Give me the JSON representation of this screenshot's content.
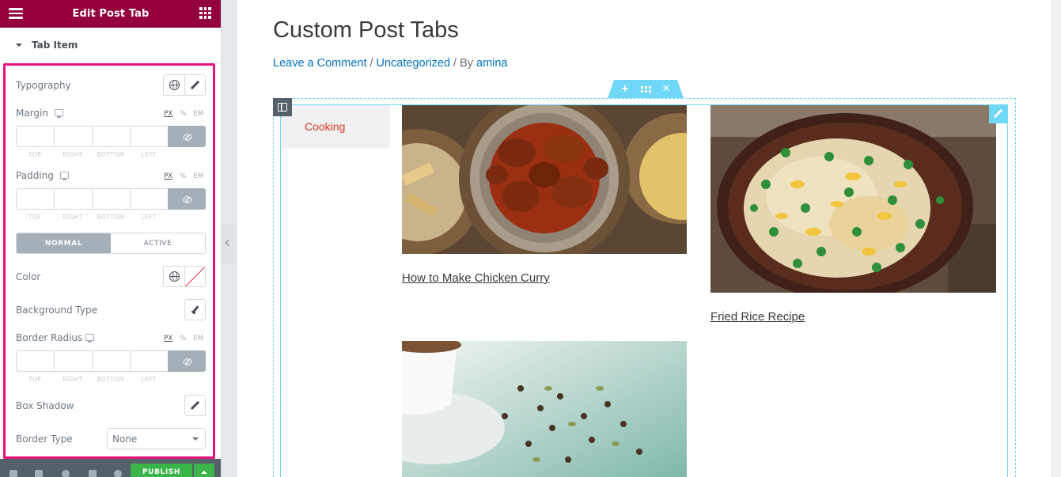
{
  "editor": {
    "header_title": "Edit Post Tab",
    "section_label": "Tab Item",
    "typography_label": "Typography",
    "margin_label": "Margin",
    "padding_label": "Padding",
    "units": [
      "PX",
      "%",
      "EM"
    ],
    "dim_labels": [
      "TOP",
      "RIGHT",
      "BOTTOM",
      "LEFT"
    ],
    "state_tabs": [
      "NORMAL",
      "ACTIVE"
    ],
    "color_label": "Color",
    "background_type_label": "Background Type",
    "border_radius_label": "Border Radius",
    "box_shadow_label": "Box Shadow",
    "border_type_label": "Border Type",
    "border_type_value": "None",
    "publish_label": "PUBLISH"
  },
  "preview": {
    "page_title": "Custom Post Tabs",
    "meta": {
      "comment_link": "Leave a Comment",
      "sep1": "/",
      "category_link": "Uncategorized",
      "sep2": "/ By",
      "author_link": "amina"
    },
    "tab_label": "Cooking",
    "posts": [
      {
        "title": "How to Make Chicken Curry",
        "image": "chicken-curry-photo"
      },
      {
        "title": "Fried Rice Recipe",
        "image": "fried-rice-photo"
      },
      {
        "title": "",
        "image": "tea-cup-cloves-photo"
      }
    ]
  },
  "colors": {
    "header_bg": "#93003c",
    "highlight": "#e8127b",
    "editor_accent": "#71d7f7",
    "link": "#0274be",
    "tab_text": "#d13a1f",
    "publish": "#39b54a"
  }
}
